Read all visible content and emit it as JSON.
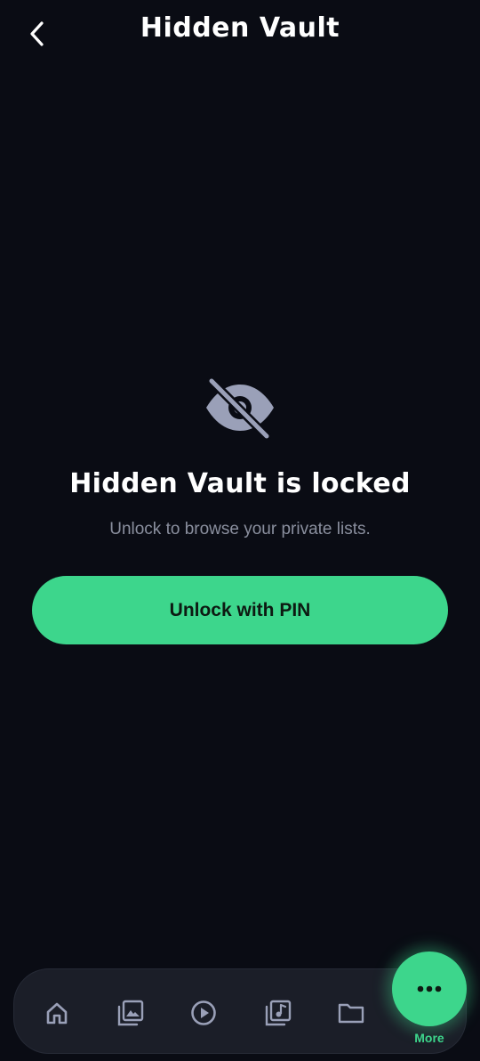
{
  "header": {
    "title": "Hidden Vault",
    "back_icon": "chevron-left-icon"
  },
  "locked": {
    "icon": "eye-off-icon",
    "title": "Hidden Vault is locked",
    "subtitle": "Unlock to browse your private lists.",
    "unlock_label": "Unlock with PIN"
  },
  "nav": {
    "items": [
      {
        "icon": "home-icon"
      },
      {
        "icon": "photo-library-icon"
      },
      {
        "icon": "play-circle-icon"
      },
      {
        "icon": "music-library-icon"
      },
      {
        "icon": "folder-icon"
      }
    ],
    "more_label": "More",
    "more_icon": "more-dots-icon"
  },
  "colors": {
    "background": "#0a0c14",
    "accent": "#3dd68c",
    "nav_bg": "#1b1e28",
    "icon_muted": "#9aa0b8",
    "subtitle": "#8a8f9e"
  }
}
